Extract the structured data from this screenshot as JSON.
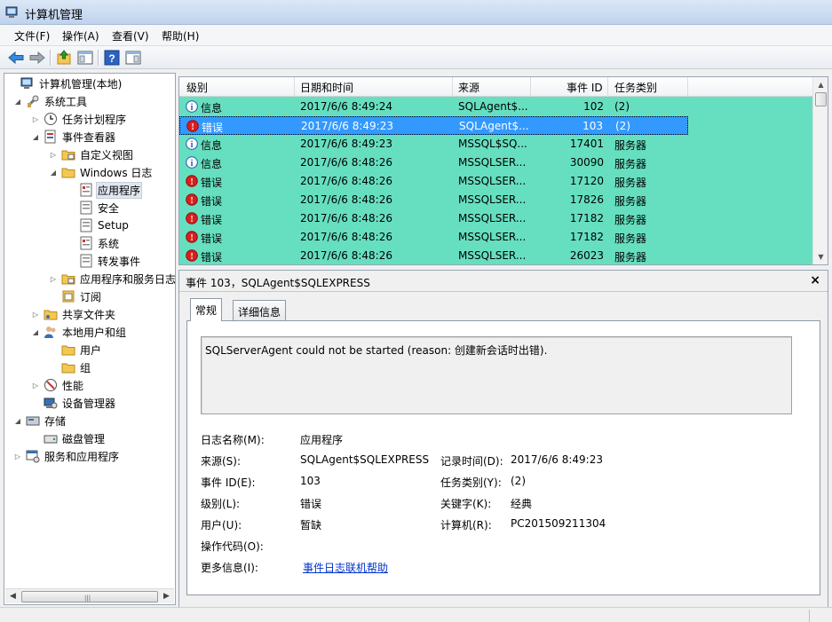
{
  "window": {
    "title": "计算机管理"
  },
  "menu": [
    "文件(F)",
    "操作(A)",
    "查看(V)",
    "帮助(H)"
  ],
  "toolbar": {
    "buttons": [
      "back-arrow-icon",
      "forward-arrow-icon",
      "up-folder-icon",
      "show-hide-tree-icon",
      "help-icon",
      "properties-pane-icon"
    ]
  },
  "tree": {
    "hscroll_grip": "|||",
    "nodes": [
      {
        "label": "计算机管理(本地)",
        "icon": "computer-management-icon",
        "expander": ""
      },
      {
        "label": "系统工具",
        "icon": "system-tools-icon",
        "expander": "◢"
      },
      {
        "label": "任务计划程序",
        "icon": "task-scheduler-icon",
        "expander": "▷"
      },
      {
        "label": "事件查看器",
        "icon": "event-viewer-icon",
        "expander": "◢"
      },
      {
        "label": "自定义视图",
        "icon": "custom-views-folder-icon",
        "expander": "▷"
      },
      {
        "label": "Windows 日志",
        "icon": "windows-logs-folder-icon",
        "expander": "◢"
      },
      {
        "label": "应用程序",
        "icon": "log-icon",
        "expander": ""
      },
      {
        "label": "安全",
        "icon": "log-icon",
        "expander": ""
      },
      {
        "label": "Setup",
        "icon": "log-icon",
        "expander": ""
      },
      {
        "label": "系统",
        "icon": "log-icon",
        "expander": ""
      },
      {
        "label": "转发事件",
        "icon": "log-icon",
        "expander": ""
      },
      {
        "label": "应用程序和服务日志",
        "icon": "app-services-logs-folder-icon",
        "expander": "▷"
      },
      {
        "label": "订阅",
        "icon": "subscriptions-icon",
        "expander": ""
      },
      {
        "label": "共享文件夹",
        "icon": "shared-folders-icon",
        "expander": "▷"
      },
      {
        "label": "本地用户和组",
        "icon": "local-users-groups-icon",
        "expander": "◢"
      },
      {
        "label": "用户",
        "icon": "folder-icon",
        "expander": ""
      },
      {
        "label": "组",
        "icon": "folder-icon",
        "expander": ""
      },
      {
        "label": "性能",
        "icon": "performance-icon",
        "expander": "▷"
      },
      {
        "label": "设备管理器",
        "icon": "device-manager-icon",
        "expander": ""
      },
      {
        "label": "存储",
        "icon": "storage-icon",
        "expander": "◢"
      },
      {
        "label": "磁盘管理",
        "icon": "disk-management-icon",
        "expander": ""
      },
      {
        "label": "服务和应用程序",
        "icon": "services-applications-icon",
        "expander": "▷"
      }
    ]
  },
  "events": {
    "columns": [
      "级别",
      "日期和时间",
      "来源",
      "事件 ID",
      "任务类别"
    ],
    "rows": [
      {
        "level": "信息",
        "type": "info",
        "datetime": "2017/6/6 8:49:24",
        "source": "SQLAgent$...",
        "id": "102",
        "category": "(2)"
      },
      {
        "level": "错误",
        "type": "error",
        "datetime": "2017/6/6 8:49:23",
        "source": "SQLAgent$...",
        "id": "103",
        "category": "(2)"
      },
      {
        "level": "信息",
        "type": "info",
        "datetime": "2017/6/6 8:49:23",
        "source": "MSSQL$SQ...",
        "id": "17401",
        "category": "服务器"
      },
      {
        "level": "信息",
        "type": "info",
        "datetime": "2017/6/6 8:48:26",
        "source": "MSSQLSER...",
        "id": "30090",
        "category": "服务器"
      },
      {
        "level": "错误",
        "type": "error",
        "datetime": "2017/6/6 8:48:26",
        "source": "MSSQLSER...",
        "id": "17120",
        "category": "服务器"
      },
      {
        "level": "错误",
        "type": "error",
        "datetime": "2017/6/6 8:48:26",
        "source": "MSSQLSER...",
        "id": "17826",
        "category": "服务器"
      },
      {
        "level": "错误",
        "type": "error",
        "datetime": "2017/6/6 8:48:26",
        "source": "MSSQLSER...",
        "id": "17182",
        "category": "服务器"
      },
      {
        "level": "错误",
        "type": "error",
        "datetime": "2017/6/6 8:48:26",
        "source": "MSSQLSER...",
        "id": "17182",
        "category": "服务器"
      },
      {
        "level": "错误",
        "type": "error",
        "datetime": "2017/6/6 8:48:26",
        "source": "MSSQLSER...",
        "id": "26023",
        "category": "服务器"
      }
    ]
  },
  "detail": {
    "header": "事件 103，SQLAgent$SQLEXPRESS",
    "close": "×",
    "tabs": [
      "常规",
      "详细信息"
    ],
    "description": "SQLServerAgent could not be started (reason: 创建新会话时出错).",
    "labels": {
      "log_name": "日志名称(M):",
      "source": "来源(S):",
      "event_id": "事件 ID(E):",
      "level": "级别(L):",
      "user": "用户(U):",
      "opcode": "操作代码(O):",
      "more_info": "更多信息(I):",
      "logged": "记录时间(D):",
      "task_category": "任务类别(Y):",
      "keywords": "关键字(K):",
      "computer": "计算机(R):"
    },
    "values": {
      "log_name": "应用程序",
      "source": "SQLAgent$SQLEXPRESS",
      "event_id": "103",
      "level": "错误",
      "user": "暂缺",
      "opcode": "",
      "more_info_link": "事件日志联机帮助",
      "logged": "2017/6/6 8:49:23",
      "task_category": "(2)",
      "keywords": "经典",
      "computer": "PC201509211304"
    }
  },
  "colors": {
    "row_highlight": "#66dfc0",
    "selection": "#3399ff",
    "error": "#d81e1e",
    "info": "#1b57b8"
  }
}
